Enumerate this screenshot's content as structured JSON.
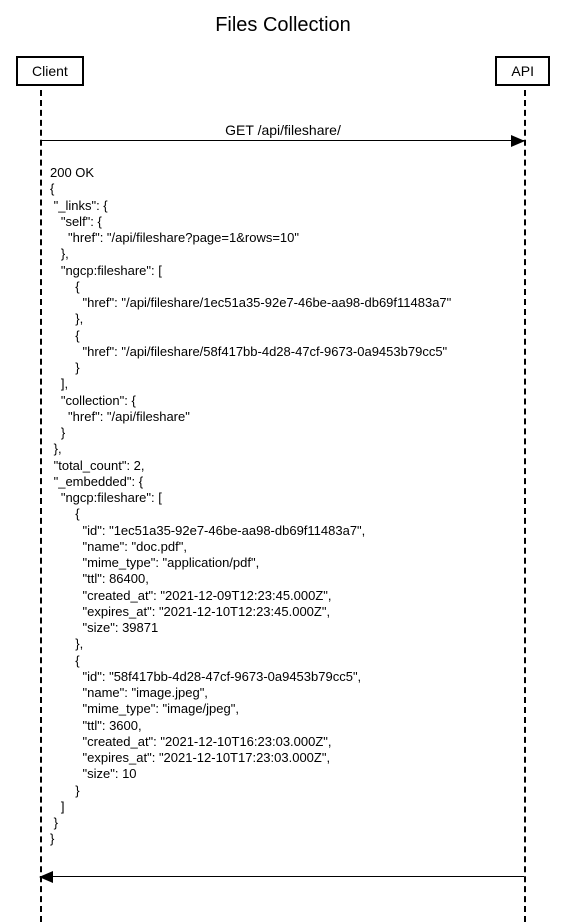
{
  "title": "Files Collection",
  "participants": {
    "client": "Client",
    "api": "API"
  },
  "request": {
    "label": "GET /api/fileshare/"
  },
  "response": {
    "status": "200 OK",
    "body": {
      "_links": {
        "self": {
          "href": "/api/fileshare?page=1&rows=10"
        },
        "ngcp:fileshare": [
          {
            "href": "/api/fileshare/1ec51a35-92e7-46be-aa98-db69f11483a7"
          },
          {
            "href": "/api/fileshare/58f417bb-4d28-47cf-9673-0a9453b79cc5"
          }
        ],
        "collection": {
          "href": "/api/fileshare"
        }
      },
      "total_count": 2,
      "_embedded": {
        "ngcp:fileshare": [
          {
            "id": "1ec51a35-92e7-46be-aa98-db69f11483a7",
            "name": "doc.pdf",
            "mime_type": "application/pdf",
            "ttl": 86400,
            "created_at": "2021-12-09T12:23:45.000Z",
            "expires_at": "2021-12-10T12:23:45.000Z",
            "size": 39871
          },
          {
            "id": "58f417bb-4d28-47cf-9673-0a9453b79cc5",
            "name": "image.jpeg",
            "mime_type": "image/jpeg",
            "ttl": 3600,
            "created_at": "2021-12-10T16:23:03.000Z",
            "expires_at": "2021-12-10T17:23:03.000Z",
            "size": 10
          }
        ]
      }
    }
  }
}
